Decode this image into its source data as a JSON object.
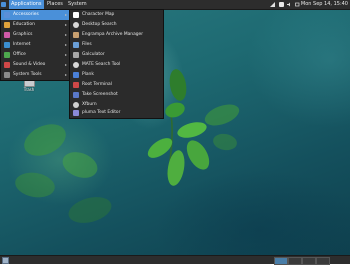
{
  "top_panel": {
    "applications_label": "Applications",
    "places_label": "Places",
    "system_label": "System",
    "clock": "Mon Sep 14, 15:40"
  },
  "desktop": {
    "trash_label": "Trash"
  },
  "categories": [
    {
      "label": "Accessories",
      "icon": "accessories-icon",
      "color": "#5a8fd8"
    },
    {
      "label": "Education",
      "icon": "education-icon",
      "color": "#e0a23b"
    },
    {
      "label": "Graphics",
      "icon": "graphics-icon",
      "color": "#d05aa8"
    },
    {
      "label": "Internet",
      "icon": "internet-icon",
      "color": "#3b8fd0"
    },
    {
      "label": "Office",
      "icon": "office-icon",
      "color": "#4ea84e"
    },
    {
      "label": "Sound & Video",
      "icon": "sound-video-icon",
      "color": "#d04848"
    },
    {
      "label": "System Tools",
      "icon": "system-tools-icon",
      "color": "#8a8a8a"
    }
  ],
  "accessories": [
    {
      "label": "Character Map",
      "icon": "character-map-icon",
      "color": "#ffffff"
    },
    {
      "label": "Desktop Search",
      "icon": "search-icon",
      "color": "#d8d8d8"
    },
    {
      "label": "Engrampa Archive Manager",
      "icon": "archive-icon",
      "color": "#c8a070"
    },
    {
      "label": "Files",
      "icon": "folder-icon",
      "color": "#6a9fd8"
    },
    {
      "label": "Galculator",
      "icon": "calculator-icon",
      "color": "#a8a8a8"
    },
    {
      "label": "MATE Search Tool",
      "icon": "search-tool-icon",
      "color": "#d8d8d8"
    },
    {
      "label": "Plank",
      "icon": "plank-icon",
      "color": "#4a80d8"
    },
    {
      "label": "Root Terminal",
      "icon": "terminal-icon",
      "color": "#d04848"
    },
    {
      "label": "Take Screenshot",
      "icon": "screenshot-icon",
      "color": "#5a78c8"
    },
    {
      "label": "Xfburn",
      "icon": "disc-burn-icon",
      "color": "#d0d0d0"
    },
    {
      "label": "pluma Text Editor",
      "icon": "text-editor-icon",
      "color": "#8a8ad8"
    }
  ],
  "colors": {
    "accent": "#4a90d9",
    "panel": "#2d2d2d",
    "menu_bg": "#2b2b2b"
  }
}
